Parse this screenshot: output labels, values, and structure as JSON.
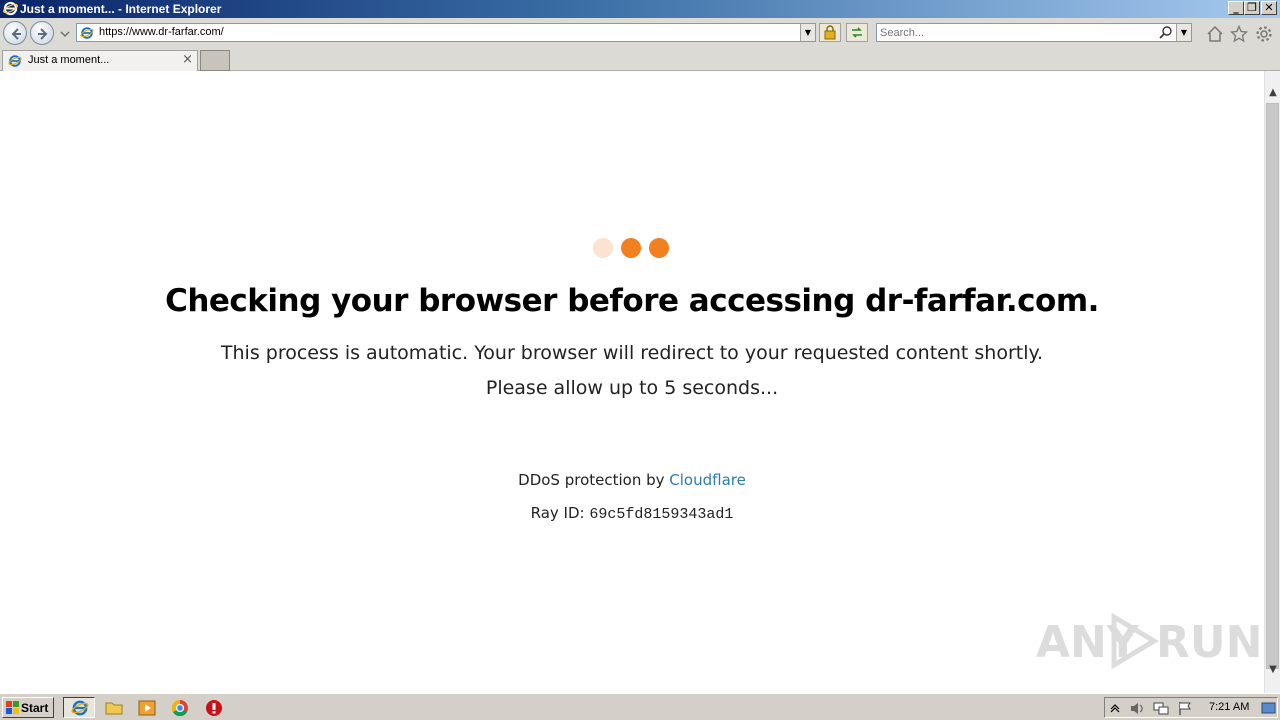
{
  "window": {
    "title": "Just a moment... - Internet Explorer",
    "buttons": [
      "_",
      "❐",
      "✕"
    ]
  },
  "navbar": {
    "url": "https://www.dr-farfar.com/",
    "search_placeholder": "Search..."
  },
  "tabs": [
    {
      "label": "Just a moment...",
      "close": "×"
    }
  ],
  "page": {
    "heading": "Checking your browser before accessing dr-farfar.com.",
    "line1": "This process is automatic. Your browser will redirect to your requested content shortly.",
    "line2": "Please allow up to 5 seconds...",
    "ddos_prefix": "DDoS protection by ",
    "ddos_link": "Cloudflare",
    "ray_label": "Ray ID: ",
    "ray_id": "69c5fd8159343ad1",
    "dot_colors": [
      "#fbe3d0",
      "#f38020",
      "#f38020"
    ],
    "link_color": "#2c7cb0"
  },
  "watermark": {
    "left": "ANY",
    "right": "RUN"
  },
  "taskbar": {
    "start_label": "Start",
    "clock": "7:21 AM"
  }
}
